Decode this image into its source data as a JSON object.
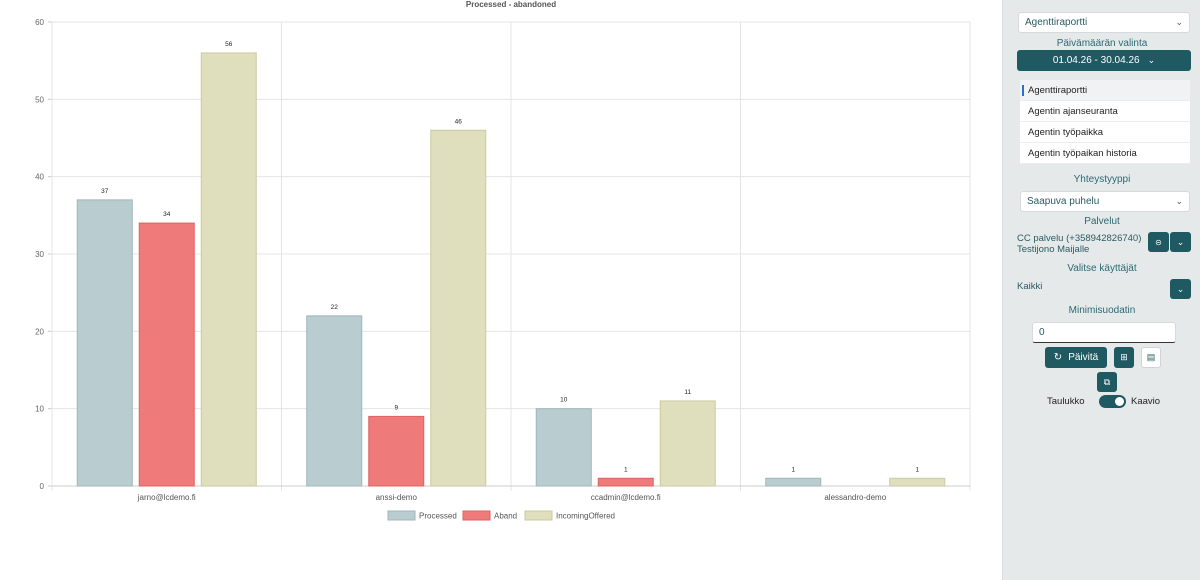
{
  "chart_data": {
    "type": "bar",
    "title": "Processed - abandoned",
    "categories": [
      "jarno@lcdemo.fi",
      "anssi-demo",
      "ccadmin@lcdemo.fi",
      "alessandro-demo"
    ],
    "series": [
      {
        "name": "Processed",
        "values": [
          37,
          22,
          10,
          1
        ],
        "color": "#b9cdd1",
        "border": "#9fb6bb"
      },
      {
        "name": "Aband",
        "values": [
          34,
          9,
          1,
          null
        ],
        "color": "#ee7a7a",
        "border": "#e06262"
      },
      {
        "name": "IncomingOffered",
        "values": [
          56,
          46,
          11,
          1
        ],
        "color": "#e0dfbd",
        "border": "#cccaa0"
      }
    ],
    "yticks": [
      0,
      10,
      20,
      30,
      40,
      50,
      60
    ],
    "ylim": [
      0,
      60
    ],
    "grid": true,
    "legend_position": "bottom"
  },
  "sidebar": {
    "report_select": "Agenttiraportti",
    "date_label": "Päivämäärän valinta",
    "date_range": "01.04.26 - 30.04.26",
    "menu_items": [
      "Agenttiraportti",
      "Agentin ajanseuranta",
      "Agentin työpaikka",
      "Agentin työpaikan historia"
    ],
    "contact_type_label": "Yhteystyyppi",
    "contact_type_value": "Saapuva puhelu",
    "services_label": "Palvelut",
    "services_line1": "CC palvelu (+358942826740)",
    "services_line2": "Testijono Maijalle",
    "users_label": "Valitse käyttäjät",
    "users_value": "Kaikki",
    "min_filter_label": "Minimisuodatin",
    "min_filter_value": "0",
    "refresh_label": "Päivitä",
    "toggle_left": "Taulukko",
    "toggle_right": "Kaavio"
  }
}
